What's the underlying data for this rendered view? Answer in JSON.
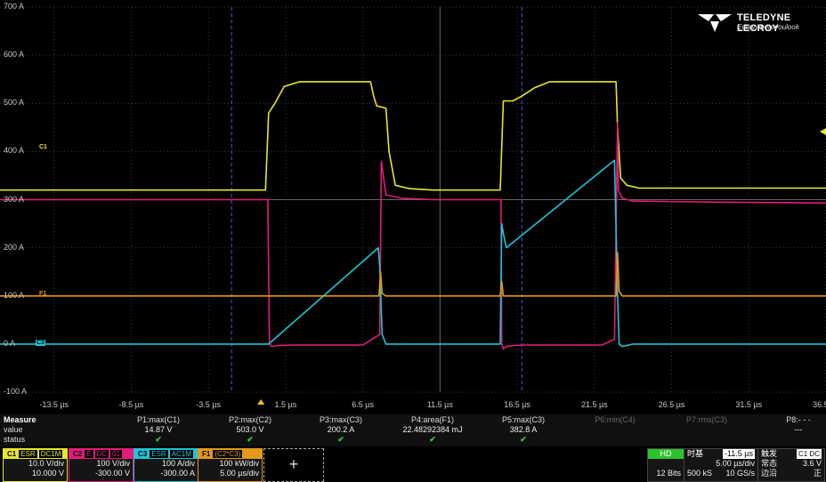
{
  "plot": {
    "y_labels": [
      "700 A",
      "600 A",
      "500 A",
      "400 A",
      "300 A",
      "200 A",
      "100 A",
      "0 A",
      "-100 A"
    ],
    "x_labels": [
      "-13.5 µs",
      "-8.5 µs",
      "-3.5 µs",
      "1.5 µs",
      "6.5 µs",
      "11.5 µs",
      "16.5 µs",
      "21.5 µs",
      "26.5 µs",
      "31.5 µs",
      "36.5 µs"
    ],
    "markers": {
      "c1": "C1",
      "f1": "F1",
      "c3": "C3"
    }
  },
  "logo": {
    "brand": "TELEDYNE LECROY",
    "tagline": "Everywhereyoulook"
  },
  "chart_data": {
    "type": "line",
    "xlabel": "",
    "ylabel": "",
    "xlim": [
      -16.0,
      37.5
    ],
    "ylim": [
      -100,
      700
    ],
    "series": [
      {
        "color": "#e6e62c",
        "x": [
          -16,
          1.2,
          1.4,
          1.8,
          2.4,
          3.4,
          8.0,
          8.2,
          8.4,
          9.0,
          9.2,
          9.6,
          10.5,
          12,
          16.4,
          16.6,
          17.2,
          17.8,
          18.6,
          19.6,
          23.9,
          24.0,
          24.2,
          24.6,
          25.4,
          27,
          37.5
        ],
        "y": [
          320,
          320,
          480,
          500,
          535,
          545,
          545,
          515,
          495,
          490,
          400,
          330,
          323,
          320,
          320,
          505,
          505,
          515,
          532,
          545,
          545,
          450,
          345,
          330,
          324,
          324,
          324
        ]
      },
      {
        "color": "#e31b7a",
        "x": [
          -16,
          1.35,
          1.45,
          1.6,
          2.0,
          3.0,
          7.5,
          8.6,
          8.7,
          9.0,
          10,
          12,
          16.45,
          16.5,
          16.6,
          16.8,
          17.3,
          18,
          23.0,
          23.8,
          24.0,
          24.05,
          24.3,
          25,
          30,
          37.5
        ],
        "y": [
          300,
          300,
          0,
          -5,
          -3,
          -2,
          -2,
          20,
          380,
          310,
          303,
          300,
          300,
          0,
          -10,
          -5,
          -3,
          -2,
          -2,
          10,
          460,
          320,
          303,
          297,
          295,
          293
        ]
      },
      {
        "color": "#21c4d6",
        "x": [
          -16,
          1.4,
          8.5,
          8.6,
          8.75,
          9.0,
          10,
          16.4,
          16.5,
          16.6,
          16.8,
          23.8,
          24.0,
          24.1,
          24.3,
          25,
          37.5
        ],
        "y": [
          0,
          0,
          200,
          160,
          20,
          0,
          0,
          0,
          250,
          230,
          200,
          382,
          100,
          0,
          -5,
          0,
          0
        ]
      },
      {
        "color": "#e39a18",
        "x": [
          -16,
          8.55,
          8.65,
          8.75,
          9.0,
          16.4,
          16.5,
          16.6,
          23.9,
          24.0,
          24.1,
          24.3,
          37.5
        ],
        "y": [
          100,
          100,
          150,
          105,
          100,
          100,
          130,
          100,
          100,
          190,
          110,
          100,
          100
        ]
      }
    ]
  },
  "measure": {
    "title": "Measure",
    "row_labels": [
      "value",
      "status"
    ],
    "params": [
      {
        "name": "P1:max(C1)",
        "value": "14.87 V",
        "ok": true
      },
      {
        "name": "P2:max(C2)",
        "value": "503.0 V",
        "ok": true
      },
      {
        "name": "P3:max(C3)",
        "value": "200.2 A",
        "ok": true
      },
      {
        "name": "P4:area(F1)",
        "value": "22.48292384 mJ",
        "ok": true
      },
      {
        "name": "P5:max(C3)",
        "value": "382.8 A",
        "ok": true
      },
      {
        "name": "P6:min(C4)",
        "value": "",
        "ok": false
      },
      {
        "name": "P7:rms(C3)",
        "value": "",
        "ok": false
      },
      {
        "name": "P8:- - -",
        "value": "---",
        "ok": false
      }
    ],
    "check": "✔"
  },
  "channels": [
    {
      "id": "C1",
      "tags": [
        "ESR",
        "DC1M"
      ],
      "v1": "10.0 V/div",
      "v2": "10.000 V",
      "color": "#e6e62c"
    },
    {
      "id": "C2",
      "tags": [
        "E",
        "DC",
        "01"
      ],
      "v1": "100 V/div",
      "v2": "-300.00 V",
      "color": "#e31b7a"
    },
    {
      "id": "C3",
      "tags": [
        "ESR",
        "AC1M"
      ],
      "v1": "100 A/div",
      "v2": "-300.00 A",
      "color": "#21c4d6"
    },
    {
      "id": "F1",
      "tags": [
        "(C2*C3)"
      ],
      "v1": "100 kW/div",
      "v2": "5.00 µs/div",
      "color": "#e39a18"
    }
  ],
  "add_label": "+",
  "acq": {
    "hd": "HD",
    "bits": "12 Bits",
    "tb_label": "时基",
    "tb_delay": "-11.5 µs",
    "tb_div": "5.00 µs/div",
    "tb_samples": "500 kS",
    "tb_rate": "10 GS/s",
    "trig_label": "触发",
    "trig_tags": "C1 DC",
    "trig_mode": "常态",
    "trig_level": "3.6 V",
    "trig_type": "边沿",
    "trig_slope": "正"
  }
}
